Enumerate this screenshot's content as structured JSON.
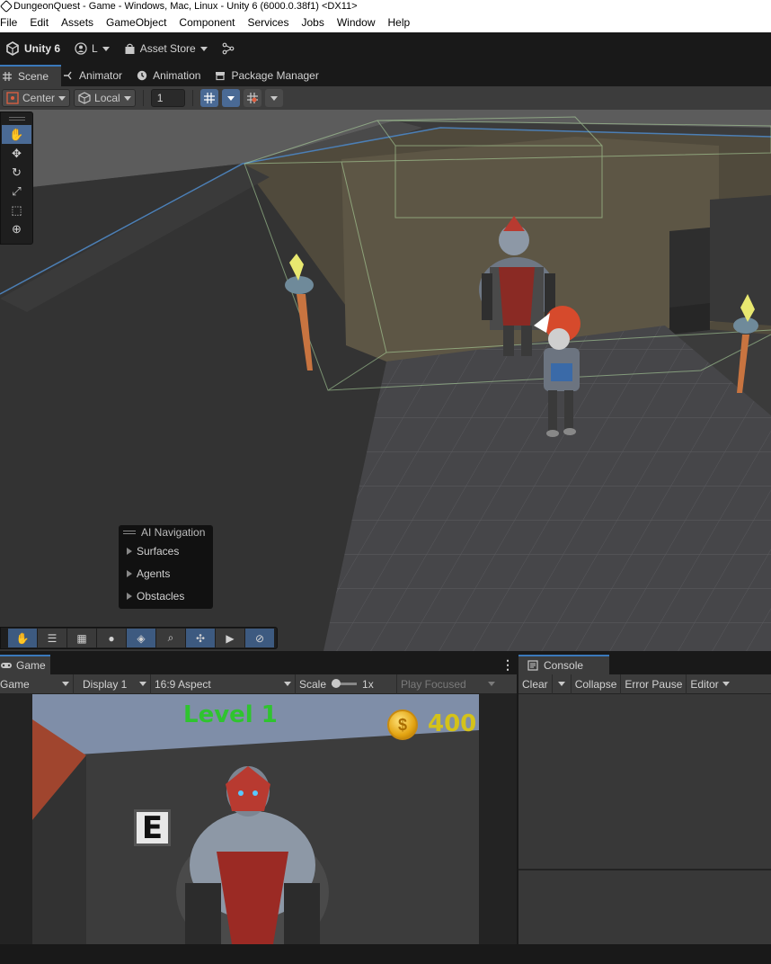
{
  "window": {
    "title": "DungeonQuest - Game - Windows, Mac, Linux - Unity 6 (6000.0.38f1) <DX11>"
  },
  "menu": [
    "File",
    "Edit",
    "Assets",
    "GameObject",
    "Component",
    "Services",
    "Jobs",
    "Window",
    "Help"
  ],
  "toolbar": {
    "brand": "Unity 6",
    "account": "L",
    "asset_store": "Asset Store"
  },
  "tabs": [
    "Scene",
    "Animator",
    "Animation",
    "Package Manager"
  ],
  "scene_toolbar": {
    "pivot": "Center",
    "space": "Local",
    "snap_value": "1"
  },
  "tools": [
    "hand-tool",
    "move-tool",
    "rotate-tool",
    "scale-tool",
    "rect-tool",
    "transform-tool"
  ],
  "ai_navigation": {
    "title": "AI Navigation",
    "items": [
      "Surfaces",
      "Agents",
      "Obstacles"
    ]
  },
  "game": {
    "tab": "Game",
    "view_mode": "Game",
    "display": "Display 1",
    "aspect": "16:9 Aspect",
    "scale_label": "Scale",
    "scale_value": "1x",
    "play_mode": "Play Focused",
    "hud": {
      "level": "Level 1",
      "coins": "400",
      "coin_symbol": "$",
      "interact_key": "E"
    }
  },
  "console": {
    "tab": "Console",
    "buttons": [
      "Clear",
      "Collapse",
      "Error Pause",
      "Editor"
    ]
  },
  "colors": {
    "accent": "#3a79bb",
    "level_text": "#2fc42f",
    "coin_text": "#d4c21a",
    "panel": "#3c3c3c"
  }
}
